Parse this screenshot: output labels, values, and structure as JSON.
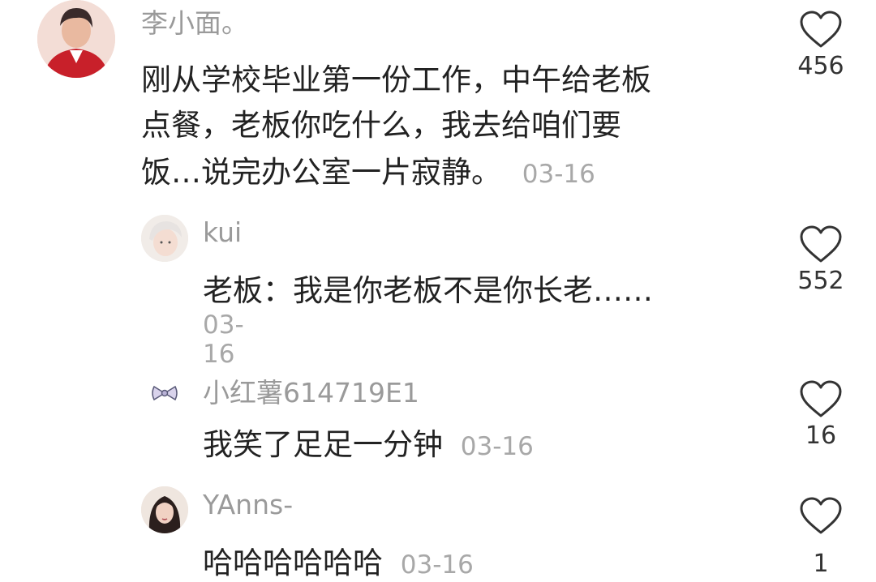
{
  "comments": [
    {
      "username": "李小面。",
      "lines": [
        "刚从学校毕业第一份工作，中午给老板",
        "点餐，老板你吃什么，我去给咱们要",
        "饭…说完办公室一片寂静。"
      ],
      "date": "03-16",
      "likes": "456",
      "avatar_icon": "avatar-woman-red-jacket"
    },
    {
      "username": "kui",
      "lines": [
        "老板：我是你老板不是你长老……"
      ],
      "date": "03-16",
      "likes": "552",
      "avatar_icon": "avatar-white-hair-cartoon"
    },
    {
      "username": "小红薯614719E1",
      "lines": [
        "我笑了足足一分钟"
      ],
      "date": "03-16",
      "likes": "16",
      "avatar_icon": "avatar-bow"
    },
    {
      "username": "YAnns-",
      "lines": [
        "哈哈哈哈哈哈"
      ],
      "date": "03-16",
      "likes": "1",
      "avatar_icon": "avatar-woman-dark-hair"
    }
  ],
  "colors": {
    "username": "#9a9a9a",
    "text": "#222222",
    "date": "#a8a8a8",
    "heart_stroke": "#333333"
  }
}
